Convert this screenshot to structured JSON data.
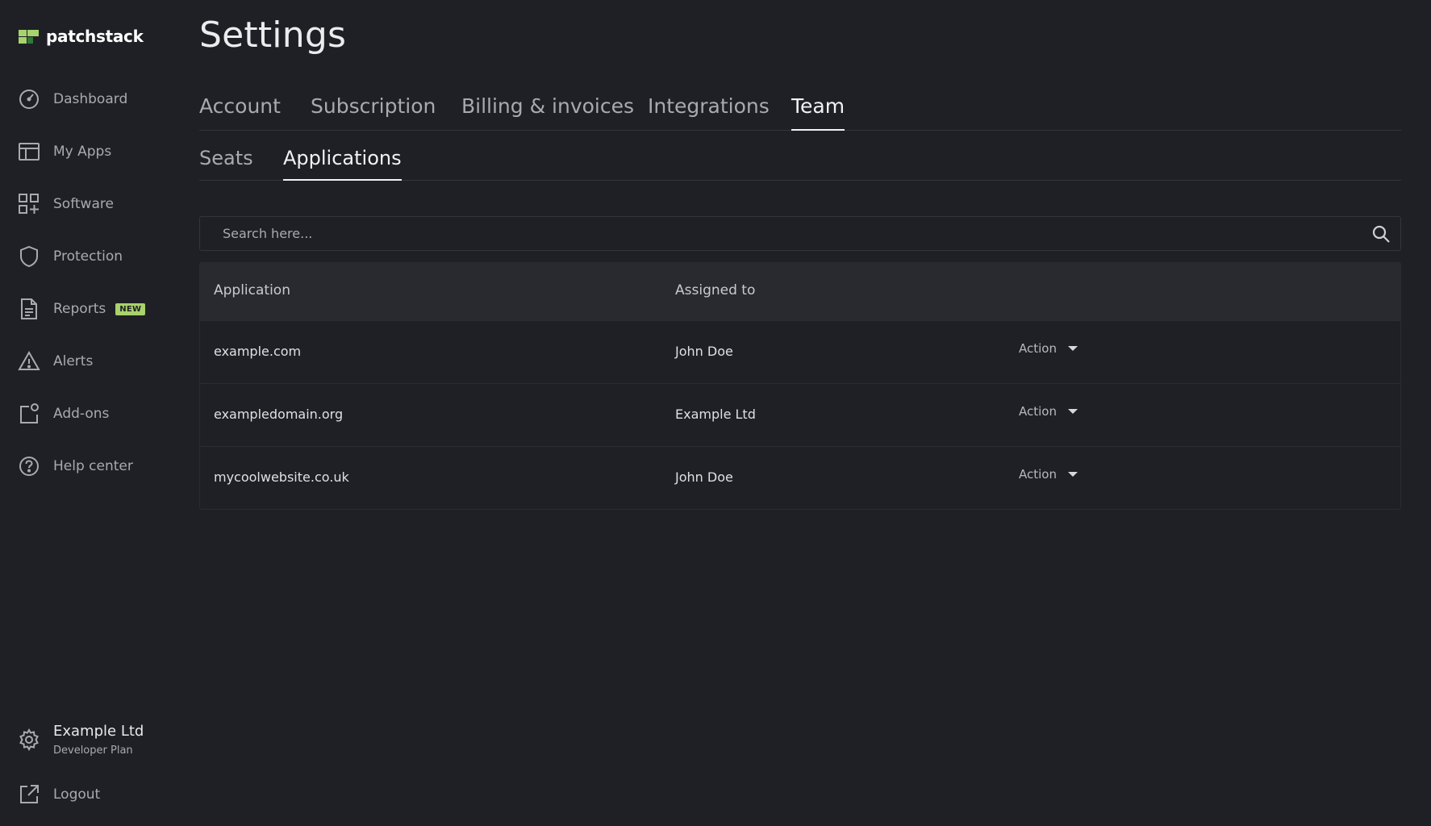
{
  "brand": {
    "name": "patchstack"
  },
  "sidebar": {
    "items": [
      {
        "label": "Dashboard",
        "icon": "dashboard-gauge-icon"
      },
      {
        "label": "My Apps",
        "icon": "layout-icon"
      },
      {
        "label": "Software",
        "icon": "grid-plus-icon"
      },
      {
        "label": "Protection",
        "icon": "shield-icon"
      },
      {
        "label": "Reports",
        "icon": "document-icon",
        "badge": "NEW"
      },
      {
        "label": "Alerts",
        "icon": "warning-triangle-icon"
      },
      {
        "label": "Add-ons",
        "icon": "addon-icon"
      },
      {
        "label": "Help center",
        "icon": "help-circle-icon"
      }
    ],
    "account": {
      "name": "Example Ltd",
      "plan": "Developer Plan"
    },
    "logout": "Logout"
  },
  "page": {
    "title": "Settings"
  },
  "tabs": [
    "Account",
    "Subscription",
    "Billing & invoices",
    "Integrations",
    "Team"
  ],
  "active_tab": "Team",
  "subtabs": [
    "Seats",
    "Applications"
  ],
  "active_subtab": "Applications",
  "search": {
    "placeholder": "Search here..."
  },
  "table": {
    "headers": [
      "Application",
      "Assigned to"
    ],
    "rows": [
      {
        "application": "example.com",
        "assigned_to": "John Doe",
        "action": "Action"
      },
      {
        "application": "exampledomain.org",
        "assigned_to": "Example Ltd",
        "action": "Action"
      },
      {
        "application": "mycoolwebsite.co.uk",
        "assigned_to": "John Doe",
        "action": "Action"
      }
    ]
  },
  "colors": {
    "accent": "#a8d26b",
    "background": "#1f2025",
    "logo_dark": "#2f7a3a"
  }
}
